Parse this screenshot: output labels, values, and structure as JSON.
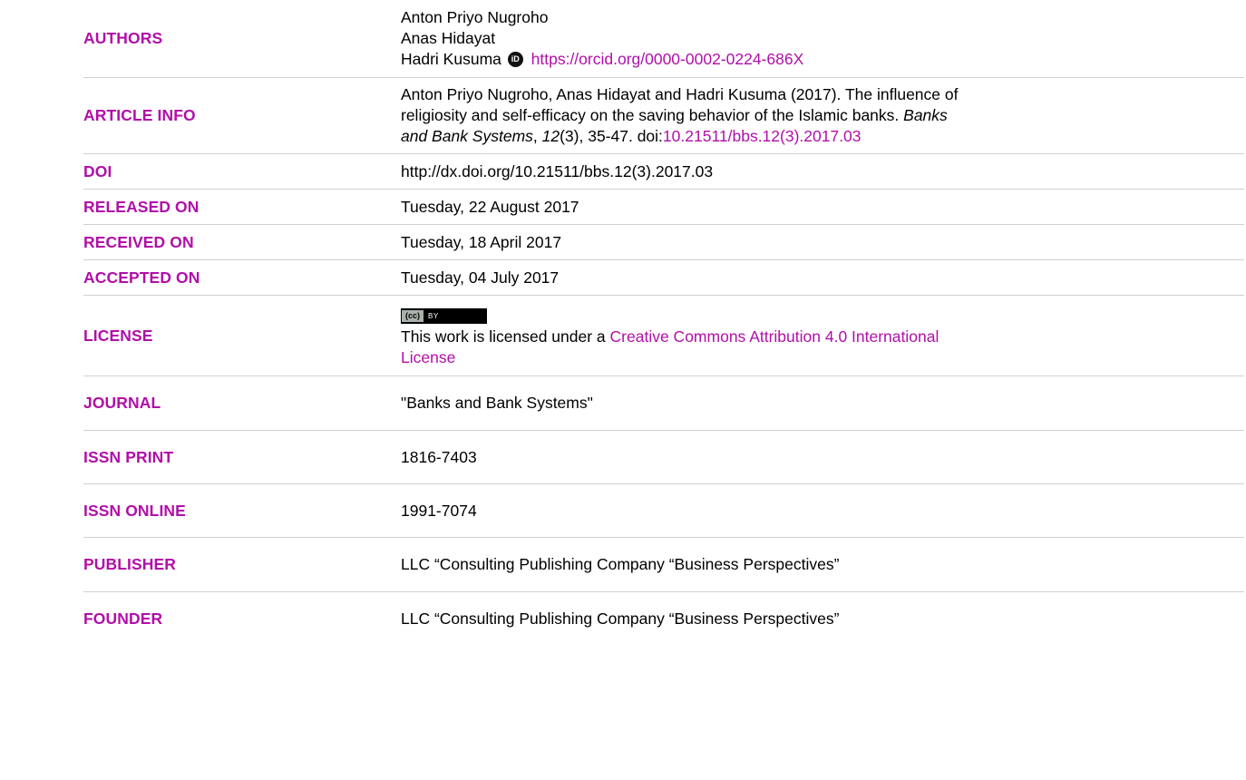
{
  "rows": {
    "authors": {
      "label": "AUTHORS",
      "names": [
        "Anton Priyo Nugroho",
        "Anas Hidayat",
        "Hadri Kusuma"
      ],
      "orcid_icon": "orcid-icon",
      "orcid_url": "https://orcid.org/0000-0002-0224-686X"
    },
    "article_info": {
      "label": "ARTICLE INFO",
      "line1": "Anton Priyo Nugroho, Anas Hidayat and Hadri Kusuma (2017). The influence of",
      "line2_text": "religiosity and self-efficacy on the saving behavior of the Islamic banks. ",
      "line2_italic": "Banks",
      "line3_italic1": "and Bank Systems",
      "line3_sep": ", ",
      "line3_italic2": "12",
      "line3_text": "(3), 35-47. doi:",
      "line3_link": "10.21511/bbs.12(3).2017.03"
    },
    "doi": {
      "label": "DOI",
      "value": "http://dx.doi.org/10.21511/bbs.12(3).2017.03"
    },
    "released": {
      "label": "RELEASED ON",
      "value": "Tuesday, 22 August 2017"
    },
    "received": {
      "label": "RECEIVED ON",
      "value": "Tuesday, 18 April 2017"
    },
    "accepted": {
      "label": "ACCEPTED ON",
      "value": "Tuesday, 04 July 2017"
    },
    "license": {
      "label": "LICENSE",
      "badge_cc": "(cc)",
      "badge_by": "BY",
      "text": "This work is licensed under a ",
      "link_line1": "Creative Commons Attribution 4.0 International",
      "link_line2": "License"
    },
    "journal": {
      "label": "JOURNAL",
      "value": "\"Banks and Bank Systems\""
    },
    "issn_print": {
      "label": "ISSN PRINT",
      "value": "1816-7403"
    },
    "issn_online": {
      "label": "ISSN ONLINE",
      "value": "1991-7074"
    },
    "publisher": {
      "label": "PUBLISHER",
      "value": "LLC “Consulting Publishing Company “Business Perspectives”"
    },
    "founder": {
      "label": "FOUNDER",
      "value": "LLC “Consulting Publishing Company “Business Perspectives”"
    }
  },
  "colors": {
    "label": "#b10fa8",
    "link": "#b10fa8",
    "separator": "#d0d0d0"
  }
}
